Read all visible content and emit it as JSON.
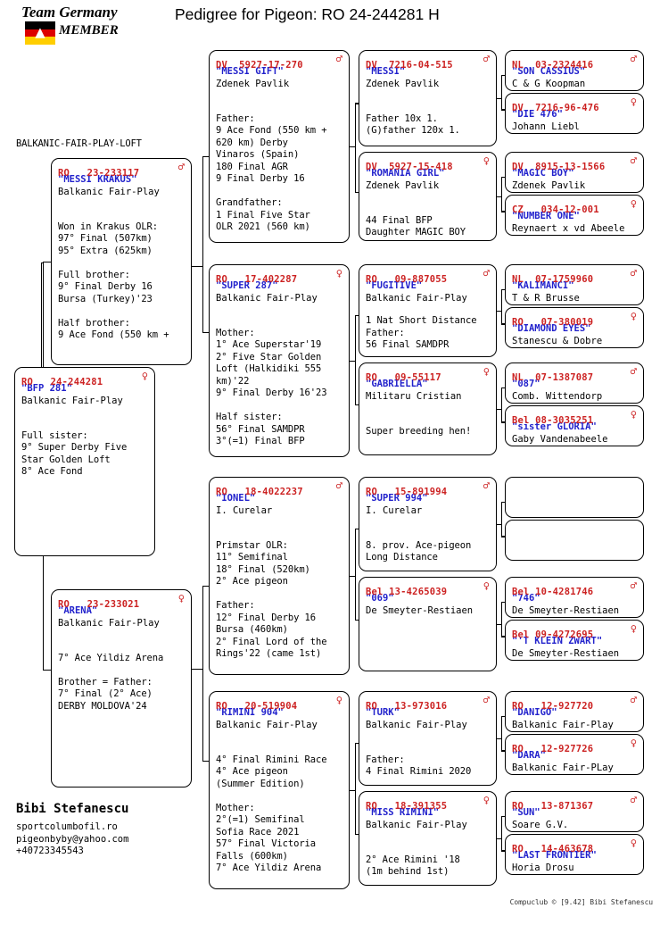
{
  "header": {
    "logo_team": "Team Germany",
    "logo_member": "MEMBER",
    "logo_eagle_icon": "eagle-icon",
    "title": "Pedigree for Pigeon: RO  24-244281 H"
  },
  "loft_label": "BALKANIC-FAIR-PLAY-LOFT",
  "owner": {
    "name": "Bibi Stefanescu",
    "website": "sportcolumbofil.ro",
    "email": "pigeonbyby@yahoo.com",
    "phone": "+40723345543"
  },
  "credit": "Compuclub © [9.42]  Bibi Stefanescu",
  "symbols": {
    "male": "♂",
    "female": "♀"
  },
  "colors": {
    "ring": "#cc2222",
    "name": "#2222cc",
    "text": "#000000"
  },
  "subject": {
    "ring": "RO   24-244281",
    "sex": "female",
    "name": "\"BFP 281\"",
    "breeder": "Balkanic Fair-Play",
    "notes": [
      "",
      "Full sister:",
      "9° Super Derby Five",
      "Star Golden Loft",
      "8° Ace Fond"
    ]
  },
  "gen1": [
    {
      "ring": "RO   23-233117",
      "sex": "male",
      "name": "\"MESSI KRAKUS\"",
      "breeder": "Balkanic Fair-Play",
      "notes": [
        "",
        "Won in Krakus OLR:",
        "97° Final (507km)",
        "95° Extra (625km)",
        "",
        "Full brother:",
        "9° Final Derby 16",
        "Bursa (Turkey)'23",
        "",
        "Half brother:",
        "9 Ace Fond (550 km +"
      ]
    },
    {
      "ring": "RO   23-233021",
      "sex": "female",
      "name": "\"ARENA\"",
      "breeder": "Balkanic Fair-Play",
      "notes": [
        "",
        "7° Ace Yildiz Arena",
        "",
        "Brother = Father:",
        "7° Final (2° Ace)",
        "DERBY MOLDOVA'24"
      ]
    }
  ],
  "gen2": [
    {
      "ring": "DV  5927-17-270",
      "sex": "male",
      "name": "\"MESSI GIFT\"",
      "breeder": "Zdenek Pavlik",
      "notes": [
        "",
        "Father:",
        "9 Ace Fond (550 km +",
        "620 km) Derby",
        "Vinaros (Spain)",
        "180 Final AGR",
        "9 Final Derby 16",
        "",
        "Grandfather:",
        "1 Final Five Star",
        "OLR 2021 (560 km)"
      ]
    },
    {
      "ring": "RO   17-402287",
      "sex": "female",
      "name": "\"SUPER 287\"",
      "breeder": "Balkanic Fair-Play",
      "notes": [
        "",
        "Mother:",
        "1° Ace Superstar'19",
        "2° Five Star Golden",
        "Loft (Halkidiki 555",
        "km)'22",
        "9° Final Derby 16'23",
        "",
        "Half sister:",
        "56° Final SAMDPR",
        "3°(=1) Final BFP"
      ]
    },
    {
      "ring": "RO   18-4022237",
      "sex": "male",
      "name": "\"IONEL\"",
      "breeder": "I. Curelar",
      "notes": [
        "",
        "Primstar OLR:",
        "11° Semifinal",
        "18° Final (520km)",
        " 2° Ace pigeon",
        "",
        "Father:",
        "12° Final Derby 16",
        "Bursa (460km)",
        "2° Final Lord of the",
        "Rings'22 (came 1st)"
      ]
    },
    {
      "ring": "RO   20-519904",
      "sex": "female",
      "name": "\"RIMINI 904\"",
      "breeder": "Balkanic Fair-Play",
      "notes": [
        "",
        "4° Final Rimini Race",
        "4° Ace pigeon",
        "(Summer Edition)",
        "",
        "Mother:",
        "2°(=1) Semifinal",
        "Sofia Race 2021",
        "57° Final Victoria",
        "Falls (600km)",
        "7° Ace Yildiz Arena"
      ]
    }
  ],
  "gen3": [
    {
      "ring": "DV  7216-04-515",
      "sex": "male",
      "name": "\"MESSI\"",
      "breeder": "Zdenek Pavlik",
      "notes": [
        "",
        "Father 10x 1.",
        "(G)father 120x 1."
      ]
    },
    {
      "ring": "DV  5927-15-418",
      "sex": "female",
      "name": "\"ROMANIA GIRL\"",
      "breeder": "Zdenek Pavlik",
      "notes": [
        "",
        "44 Final BFP",
        "Daughter MAGIC BOY"
      ]
    },
    {
      "ring": "RO   09-887055",
      "sex": "male",
      "name": "\"FUGITIVE\"",
      "breeder": "Balkanic Fair-Play",
      "notes": [
        "1 Nat Short Distance",
        "Father:",
        "56 Final SAMDPR"
      ]
    },
    {
      "ring": "RO   09-55117",
      "sex": "female",
      "name": "\"GABRIELLA\"",
      "breeder": "Militaru Cristian",
      "notes": [
        "",
        "Super breeding hen!"
      ]
    },
    {
      "ring": "RO   15-891994",
      "sex": "male",
      "name": "\"SUPER 994\"",
      "breeder": "I. Curelar",
      "notes": [
        "",
        "8. prov. Ace-pigeon",
        "Long Distance"
      ]
    },
    {
      "ring": "Bel 13-4265039",
      "sex": "female",
      "name": "\"069\"",
      "breeder": "De Smeyter-Restiaen",
      "notes": []
    },
    {
      "ring": "RO   13-973016",
      "sex": "male",
      "name": "\"TURK\"",
      "breeder": "Balkanic Fair-Play",
      "notes": [
        "",
        "Father:",
        "4 Final Rimini 2020"
      ]
    },
    {
      "ring": "RO   18-391355",
      "sex": "female",
      "name": "\"MISS RIMINI\"",
      "breeder": "Balkanic Fair-Play",
      "notes": [
        "",
        "2° Ace Rimini '18",
        "(1m behind 1st)"
      ]
    }
  ],
  "gen4": [
    {
      "ring": "NL  03-2324416",
      "sex": "male",
      "name": "\"SON CASSIUS\"",
      "breeder": "C & G Koopman",
      "empty": false
    },
    {
      "ring": "DV  7216-96-476",
      "sex": "female",
      "name": "\"DIE 476\"",
      "breeder": "Johann Liebl",
      "empty": false
    },
    {
      "ring": "DV  8915-13-1566",
      "sex": "male",
      "name": "\"MAGIC BOY\"",
      "breeder": "Zdenek Pavlik",
      "empty": false
    },
    {
      "ring": "CZ   034-12-001",
      "sex": "female",
      "name": "\"NUMBER ONE\"",
      "breeder": "Reynaert x vd Abeele",
      "empty": false
    },
    {
      "ring": "NL  07-1759960",
      "sex": "male",
      "name": "\"KALIMANCI\"",
      "breeder": "T & R Brusse",
      "empty": false
    },
    {
      "ring": "RO   07-380019",
      "sex": "female",
      "name": "\"DIAMOND EYES\"",
      "breeder": "Stanescu & Dobre",
      "empty": false
    },
    {
      "ring": "NL  07-1387087",
      "sex": "male",
      "name": "\"087\"",
      "breeder": "Comb. Wittendorp",
      "empty": false
    },
    {
      "ring": "Bel 08-3035251",
      "sex": "female",
      "name": "\"sister GLORIA\"",
      "breeder": "Gaby Vandenabeele",
      "empty": false
    },
    {
      "ring": "",
      "sex": "",
      "name": "",
      "breeder": "",
      "empty": true
    },
    {
      "ring": "",
      "sex": "",
      "name": "",
      "breeder": "",
      "empty": true
    },
    {
      "ring": "Bel 10-4281746",
      "sex": "male",
      "name": "\"746\"",
      "breeder": "De Smeyter-Restiaen",
      "empty": false
    },
    {
      "ring": "Bel 09-4272695",
      "sex": "female",
      "name": "\"'T KLEIN ZWART\"",
      "breeder": "De Smeyter-Restiaen",
      "empty": false
    },
    {
      "ring": "RO   12-927720",
      "sex": "male",
      "name": "\"DANIGO\"",
      "breeder": "Balkanic Fair-Play",
      "empty": false
    },
    {
      "ring": "RO   12-927726",
      "sex": "female",
      "name": "\"DARA\"",
      "breeder": "Balkanic Fair-PLay",
      "empty": false
    },
    {
      "ring": "RO   13-871367",
      "sex": "male",
      "name": "\"SUN\"",
      "breeder": "Soare G.V.",
      "empty": false
    },
    {
      "ring": "RO   14-463678",
      "sex": "female",
      "name": "\"LAST FRONTIER\"",
      "breeder": "Horia Drosu",
      "empty": false
    }
  ]
}
